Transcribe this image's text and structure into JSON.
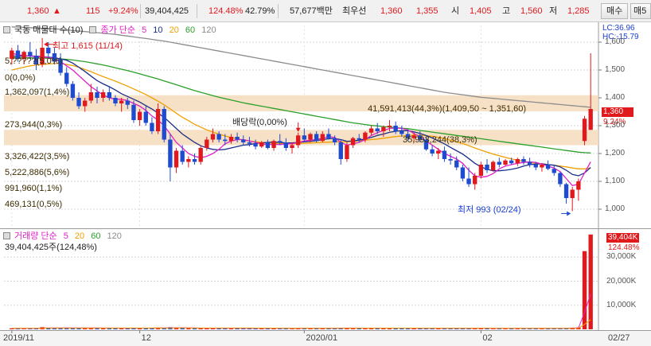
{
  "colors": {
    "up": "#e0191c",
    "down": "#1f4bd0",
    "ma5": "#e020c8",
    "ma10": "#1c2f8a",
    "ma20": "#f0a000",
    "ma60": "#2aa02a",
    "ma120": "#8c8c8c",
    "vp_band": "#f5dcbc"
  },
  "ticker": {
    "price": "1,360",
    "arrow": "▲",
    "change": "115",
    "change_pct": "+9.24%",
    "volume": "39,404,425",
    "volume_ratio": "124.48%",
    "turnover_pct": "42.79%",
    "amount": "57,677백만",
    "best_label": "최우선",
    "best_ask": "1,360",
    "best_bid": "1,355",
    "open_label": "시",
    "open": "1,405",
    "high_label": "고",
    "high": "1,560",
    "low_label": "저",
    "low": "1,285",
    "buy_button": "매수",
    "sell_button": "매5"
  },
  "main_legend": {
    "stock_name": "국동 매물대 수(10)",
    "ma_title": "종가 단순",
    "ma5": "5",
    "ma10": "10",
    "ma20": "20",
    "ma60": "60",
    "ma120": "120"
  },
  "vol_legend": {
    "title": "거래량 단순",
    "ma5": "5",
    "ma20": "20",
    "ma60": "60",
    "ma120": "120",
    "value": "39,404,425주(124,48%)"
  },
  "corner": {
    "lc": "LC:36.96",
    "hc": "HC:-15.79"
  },
  "annotations": {
    "high": "최고 1,615 (11/14)",
    "low": "최저 993 (02/24)",
    "dividend": "배당락(0,00%)",
    "vp_top": "41,591,413(44,3%)(1,409,50 ~ 1,351,60)",
    "vp_mid": "35,993,244(38,3%)"
  },
  "volume_profile": [
    "5,?????(5,0%)",
    "0(0,0%)",
    "1,362,097(1,4%)",
    "273,944(0,3%)",
    "3,326,422(3,5%)",
    "5,222,886(5,6%)",
    "991,960(1,1%)",
    "469,131(0,5%)"
  ],
  "price_tags": {
    "price": "1,360",
    "pct": "9.24%"
  },
  "vol_tags": {
    "value": "39,404K",
    "pct": "124.48%"
  },
  "chart_data": {
    "type": "candlestick",
    "y_ticks": [
      1000,
      1100,
      1200,
      1300,
      1400,
      1500,
      1600
    ],
    "y_tick_labels": [
      "1,000",
      "1,100",
      "1,200",
      "1,300",
      "1,400",
      "1,500",
      "1,600"
    ],
    "ylim": [
      940,
      1660
    ],
    "vol_ticks": [
      10000,
      20000,
      30000
    ],
    "vol_tick_labels": [
      "10,000K",
      "20,000K",
      "30,000K"
    ],
    "vol_ylim": [
      0,
      41000
    ],
    "x_labels": [
      "2019/11",
      "12",
      "2020/01",
      "02",
      "02/27"
    ],
    "x_label_index": [
      0,
      21,
      48,
      77,
      107
    ],
    "candles": [
      [
        1540,
        1580,
        1520,
        1570
      ],
      [
        1570,
        1590,
        1530,
        1540
      ],
      [
        1540,
        1570,
        1520,
        1565
      ],
      [
        1565,
        1600,
        1540,
        1550
      ],
      [
        1550,
        1575,
        1500,
        1520
      ],
      [
        1520,
        1615,
        1510,
        1580
      ],
      [
        1580,
        1600,
        1545,
        1560
      ],
      [
        1560,
        1580,
        1520,
        1530
      ],
      [
        1540,
        1560,
        1480,
        1490
      ],
      [
        1490,
        1510,
        1440,
        1450
      ],
      [
        1450,
        1460,
        1390,
        1400
      ],
      [
        1400,
        1420,
        1360,
        1370
      ],
      [
        1370,
        1400,
        1350,
        1390
      ],
      [
        1390,
        1450,
        1380,
        1420
      ],
      [
        1420,
        1440,
        1380,
        1400
      ],
      [
        1400,
        1430,
        1385,
        1420
      ],
      [
        1420,
        1440,
        1390,
        1400
      ],
      [
        1400,
        1410,
        1370,
        1380
      ],
      [
        1380,
        1400,
        1350,
        1390
      ],
      [
        1390,
        1400,
        1360,
        1375
      ],
      [
        1375,
        1390,
        1310,
        1320
      ],
      [
        1320,
        1360,
        1300,
        1350
      ],
      [
        1350,
        1370,
        1300,
        1310
      ],
      [
        1310,
        1330,
        1270,
        1280
      ],
      [
        1280,
        1380,
        1270,
        1360
      ],
      [
        1360,
        1370,
        1240,
        1250
      ],
      [
        1250,
        1270,
        1100,
        1150
      ],
      [
        1150,
        1220,
        1130,
        1210
      ],
      [
        1210,
        1230,
        1160,
        1170
      ],
      [
        1170,
        1190,
        1150,
        1180
      ],
      [
        1180,
        1200,
        1160,
        1170
      ],
      [
        1170,
        1230,
        1160,
        1220
      ],
      [
        1220,
        1260,
        1210,
        1250
      ],
      [
        1250,
        1290,
        1240,
        1270
      ],
      [
        1270,
        1280,
        1240,
        1250
      ],
      [
        1250,
        1270,
        1230,
        1245
      ],
      [
        1245,
        1270,
        1235,
        1260
      ],
      [
        1260,
        1275,
        1240,
        1250
      ],
      [
        1250,
        1265,
        1230,
        1240
      ],
      [
        1240,
        1260,
        1225,
        1235
      ],
      [
        1235,
        1250,
        1215,
        1225
      ],
      [
        1225,
        1245,
        1220,
        1240
      ],
      [
        1240,
        1250,
        1215,
        1220
      ],
      [
        1220,
        1250,
        1210,
        1245
      ],
      [
        1245,
        1270,
        1230,
        1240
      ],
      [
        1240,
        1255,
        1210,
        1220
      ],
      [
        1220,
        1240,
        1200,
        1230
      ],
      [
        1230,
        1275,
        1220,
        1265
      ],
      [
        1265,
        1290,
        1240,
        1250
      ],
      [
        1250,
        1275,
        1240,
        1270
      ],
      [
        1270,
        1280,
        1240,
        1245
      ],
      [
        1245,
        1280,
        1240,
        1270
      ],
      [
        1270,
        1290,
        1250,
        1255
      ],
      [
        1255,
        1265,
        1230,
        1240
      ],
      [
        1240,
        1250,
        1160,
        1180
      ],
      [
        1180,
        1240,
        1170,
        1230
      ],
      [
        1230,
        1260,
        1220,
        1255
      ],
      [
        1255,
        1270,
        1240,
        1250
      ],
      [
        1250,
        1280,
        1240,
        1275
      ],
      [
        1275,
        1300,
        1265,
        1290
      ],
      [
        1290,
        1310,
        1270,
        1280
      ],
      [
        1280,
        1300,
        1260,
        1295
      ],
      [
        1295,
        1320,
        1280,
        1300
      ],
      [
        1300,
        1315,
        1270,
        1280
      ],
      [
        1280,
        1300,
        1260,
        1270
      ],
      [
        1270,
        1285,
        1245,
        1255
      ],
      [
        1255,
        1275,
        1240,
        1265
      ],
      [
        1265,
        1280,
        1240,
        1250
      ],
      [
        1250,
        1260,
        1210,
        1215
      ],
      [
        1215,
        1230,
        1190,
        1200
      ],
      [
        1200,
        1220,
        1180,
        1210
      ],
      [
        1210,
        1225,
        1170,
        1180
      ],
      [
        1180,
        1200,
        1160,
        1175
      ],
      [
        1175,
        1190,
        1140,
        1150
      ],
      [
        1150,
        1160,
        1100,
        1110
      ],
      [
        1110,
        1150,
        1080,
        1090
      ],
      [
        1090,
        1130,
        1070,
        1120
      ],
      [
        1120,
        1170,
        1110,
        1160
      ],
      [
        1160,
        1180,
        1130,
        1140
      ],
      [
        1140,
        1175,
        1135,
        1170
      ],
      [
        1170,
        1185,
        1150,
        1160
      ],
      [
        1160,
        1180,
        1155,
        1175
      ],
      [
        1175,
        1185,
        1160,
        1165
      ],
      [
        1165,
        1185,
        1155,
        1180
      ],
      [
        1180,
        1190,
        1160,
        1170
      ],
      [
        1170,
        1185,
        1150,
        1160
      ],
      [
        1160,
        1170,
        1140,
        1150
      ],
      [
        1150,
        1165,
        1135,
        1160
      ],
      [
        1160,
        1175,
        1140,
        1145
      ],
      [
        1145,
        1160,
        1120,
        1130
      ],
      [
        1130,
        1135,
        1080,
        1090
      ],
      [
        1090,
        1095,
        1020,
        1040
      ],
      [
        1040,
        1080,
        993,
        1070
      ],
      [
        1070,
        1110,
        1030,
        1100
      ],
      [
        1245,
        1335,
        1230,
        1325
      ],
      [
        1285,
        1560,
        1285,
        1360
      ]
    ],
    "ma5": [
      1560,
      1555,
      1552,
      1550,
      1548,
      1547,
      1545,
      1540,
      1530,
      1515,
      1500,
      1480,
      1460,
      1440,
      1425,
      1410,
      1400,
      1395,
      1395,
      1390,
      1380,
      1370,
      1355,
      1335,
      1320,
      1300,
      1270,
      1240,
      1220,
      1200,
      1190,
      1185,
      1190,
      1200,
      1215,
      1235,
      1245,
      1250,
      1250,
      1245,
      1240,
      1235,
      1232,
      1233,
      1232,
      1235,
      1235,
      1240,
      1245,
      1248,
      1250,
      1255,
      1260,
      1258,
      1240,
      1230,
      1235,
      1240,
      1250,
      1265,
      1275,
      1283,
      1290,
      1292,
      1290,
      1285,
      1272,
      1260,
      1245,
      1230,
      1215,
      1200,
      1190,
      1180,
      1165,
      1140,
      1120,
      1115,
      1118,
      1128,
      1145,
      1155,
      1160,
      1165,
      1168,
      1170,
      1168,
      1162,
      1155,
      1148,
      1135,
      1110,
      1085,
      1090,
      1130,
      1170
    ],
    "ma10": [
      1550,
      1550,
      1550,
      1550,
      1550,
      1548,
      1546,
      1544,
      1540,
      1535,
      1525,
      1510,
      1495,
      1478,
      1462,
      1450,
      1440,
      1428,
      1415,
      1405,
      1395,
      1385,
      1372,
      1360,
      1345,
      1330,
      1310,
      1290,
      1270,
      1255,
      1240,
      1228,
      1220,
      1215,
      1213,
      1215,
      1220,
      1225,
      1230,
      1232,
      1236,
      1238,
      1240,
      1241,
      1240,
      1238,
      1238,
      1240,
      1242,
      1244,
      1246,
      1250,
      1253,
      1254,
      1250,
      1244,
      1245,
      1248,
      1252,
      1258,
      1265,
      1270,
      1276,
      1280,
      1282,
      1282,
      1278,
      1272,
      1265,
      1256,
      1245,
      1235,
      1222,
      1210,
      1198,
      1182,
      1165,
      1152,
      1143,
      1138,
      1138,
      1140,
      1143,
      1148,
      1155,
      1160,
      1162,
      1163,
      1160,
      1158,
      1152,
      1140,
      1125,
      1120,
      1130,
      1150
    ],
    "ma20": [
      1500,
      1505,
      1510,
      1515,
      1518,
      1520,
      1522,
      1523,
      1523,
      1520,
      1516,
      1510,
      1502,
      1494,
      1485,
      1476,
      1468,
      1460,
      1451,
      1442,
      1432,
      1422,
      1412,
      1400,
      1388,
      1375,
      1360,
      1345,
      1330,
      1318,
      1305,
      1295,
      1285,
      1277,
      1270,
      1263,
      1258,
      1253,
      1248,
      1245,
      1242,
      1240,
      1238,
      1237,
      1236,
      1235,
      1235,
      1236,
      1237,
      1238,
      1239,
      1240,
      1241,
      1242,
      1242,
      1242,
      1244,
      1246,
      1248,
      1250,
      1252,
      1255,
      1258,
      1261,
      1263,
      1265,
      1266,
      1266,
      1264,
      1262,
      1258,
      1254,
      1248,
      1242,
      1236,
      1228,
      1220,
      1212,
      1205,
      1198,
      1192,
      1186,
      1181,
      1176,
      1172,
      1168,
      1165,
      1163,
      1160,
      1158,
      1155,
      1152,
      1148,
      1145,
      1145,
      1148
    ],
    "ma60": [
      1545,
      1545,
      1544,
      1544,
      1543,
      1543,
      1542,
      1541,
      1540,
      1538,
      1536,
      1533,
      1530,
      1526,
      1522,
      1518,
      1513,
      1508,
      1503,
      1498,
      1492,
      1486,
      1480,
      1474,
      1468,
      1461,
      1454,
      1447,
      1440,
      1433,
      1426,
      1420,
      1414,
      1408,
      1402,
      1397,
      1392,
      1387,
      1382,
      1378,
      1374,
      1370,
      1366,
      1362,
      1358,
      1354,
      1350,
      1346,
      1342,
      1338,
      1334,
      1330,
      1326,
      1322,
      1318,
      1314,
      1310,
      1307,
      1304,
      1301,
      1299,
      1297,
      1295,
      1293,
      1291,
      1289,
      1286,
      1283,
      1280,
      1277,
      1274,
      1271,
      1268,
      1265,
      1262,
      1259,
      1256,
      1253,
      1250,
      1247,
      1244,
      1241,
      1238,
      1235,
      1232,
      1229,
      1226,
      1223,
      1220,
      1217,
      1214,
      1211,
      1208,
      1205,
      1203,
      1202
    ],
    "ma120": [
      1655,
      1654,
      1653,
      1652,
      1651,
      1650,
      1649,
      1648,
      1646,
      1644,
      1642,
      1640,
      1638,
      1636,
      1634,
      1632,
      1630,
      1628,
      1625,
      1622,
      1619,
      1616,
      1613,
      1610,
      1607,
      1604,
      1600,
      1596,
      1592,
      1588,
      1584,
      1580,
      1576,
      1572,
      1568,
      1564,
      1560,
      1556,
      1552,
      1548,
      1544,
      1540,
      1536,
      1532,
      1528,
      1524,
      1520,
      1516,
      1512,
      1508,
      1504,
      1500,
      1496,
      1492,
      1488,
      1484,
      1480,
      1476,
      1472,
      1468,
      1464,
      1460,
      1456,
      1452,
      1448,
      1444,
      1440,
      1436,
      1432,
      1428,
      1424,
      1420,
      1417,
      1414,
      1411,
      1408,
      1405,
      1402,
      1400,
      1398,
      1396,
      1394,
      1392,
      1390,
      1388,
      1386,
      1384,
      1382,
      1380,
      1378,
      1376,
      1374,
      1372,
      1370,
      1368,
      1366
    ],
    "volume": [
      400,
      420,
      380,
      500,
      450,
      900,
      600,
      480,
      520,
      560,
      600,
      580,
      620,
      520,
      480,
      500,
      470,
      460,
      440,
      450,
      520,
      560,
      500,
      480,
      700,
      650,
      900,
      600,
      500,
      450,
      420,
      460,
      520,
      500,
      460,
      440,
      430,
      420,
      410,
      400,
      390,
      400,
      380,
      390,
      420,
      430,
      410,
      520,
      480,
      460,
      440,
      470,
      500,
      480,
      600,
      520,
      480,
      460,
      500,
      540,
      520,
      500,
      480,
      460,
      440,
      430,
      420,
      410,
      430,
      440,
      420,
      410,
      400,
      420,
      450,
      500,
      460,
      440,
      420,
      410,
      400,
      390,
      400,
      410,
      400,
      390,
      380,
      400,
      410,
      420,
      460,
      520,
      700,
      800,
      32500,
      39404
    ],
    "vp_bands": [
      {
        "pct": 44.3,
        "lo": 1351.6,
        "hi": 1409.5
      },
      {
        "pct": 38.3,
        "lo": 1230,
        "hi": 1285
      }
    ]
  }
}
